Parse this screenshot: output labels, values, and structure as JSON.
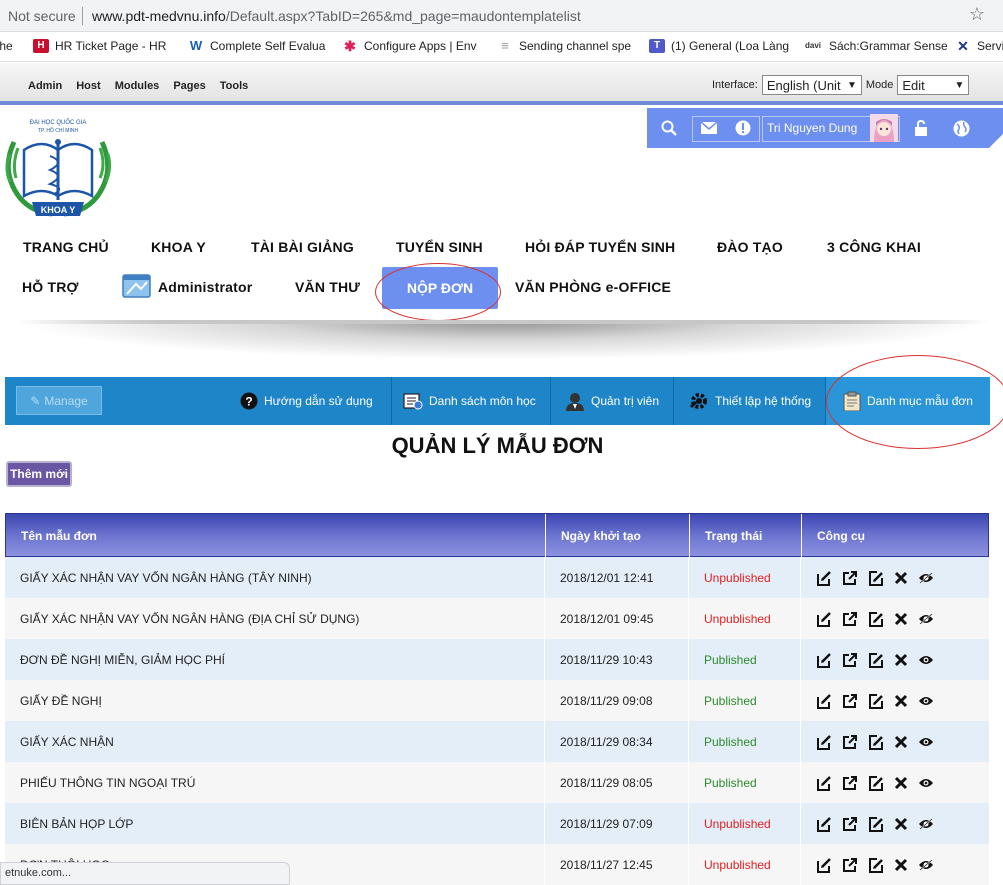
{
  "browser": {
    "security": "Not secure",
    "url_host": "www.pdt-medvnu.info",
    "url_path": "/Default.aspx?TabID=265&md_page=maudontemplatelist",
    "bookmarks": [
      {
        "label": "the",
        "icon": "bookmark-icon"
      },
      {
        "label": "HR Ticket Page - HR",
        "icon": "hr-icon"
      },
      {
        "label": "Complete Self Evalua",
        "icon": "w-icon"
      },
      {
        "label": "Configure Apps | Env",
        "icon": "slack-icon"
      },
      {
        "label": "Sending channel spe",
        "icon": "doc-icon"
      },
      {
        "label": "(1) General (Loa Làng",
        "icon": "teams-icon"
      },
      {
        "label": "Sách:Grammar Sense",
        "icon": "davi-icon"
      },
      {
        "label": "Servi",
        "icon": "tool-icon"
      }
    ]
  },
  "controlbar": {
    "menu": [
      "Admin",
      "Host",
      "Modules",
      "Pages",
      "Tools"
    ],
    "interface_label": "Interface:",
    "interface_value": "English (Unit",
    "mode_label": "Mode",
    "mode_value": "Edit"
  },
  "userbar": {
    "user_name": "Tri Nguyen Dung"
  },
  "logo": {
    "top_text": "ĐẠI HỌC QUỐC GIA",
    "city_text": "TP. HỒ CHÍ MINH",
    "ribbon_text": "KHOA Y"
  },
  "nav": {
    "row1": [
      "TRANG CHỦ",
      "KHOA Y",
      "TÀI BÀI GIẢNG",
      "TUYỂN SINH",
      "HỎI ĐÁP TUYỂN SINH",
      "ĐÀO TẠO",
      "3 CÔNG KHAI"
    ],
    "row2_support": "HỖ TRỢ",
    "row2_admin": "Administrator",
    "row2_clerical": "VĂN THƯ",
    "row2_active": "NỘP ĐƠN",
    "row2_office": "VĂN PHÒNG e-OFFICE"
  },
  "modbar": {
    "manage": "Manage",
    "items": [
      "Hướng dẫn sử dụng",
      "Danh sách môn học",
      "Quản trị viên",
      "Thiết lập hệ thống",
      "Danh mục mẫu đơn"
    ]
  },
  "page": {
    "title": "QUẢN LÝ MẪU ĐƠN",
    "add_button": "Thêm mới"
  },
  "table": {
    "headers": [
      "Tên mẫu đơn",
      "Ngày khởi tạo",
      "Trạng thái",
      "Công cụ"
    ],
    "rows": [
      {
        "name": "GIẤY XÁC NHẬN VAY VỐN NGÂN HÀNG (TÂY NINH)",
        "date": "2018/12/01 12:41",
        "status": "Unpublished"
      },
      {
        "name": "GIẤY XÁC NHẬN VAY VỐN NGÂN HÀNG (ĐỊA CHỈ SỬ DỤNG)",
        "date": "2018/12/01 09:45",
        "status": "Unpublished"
      },
      {
        "name": "ĐƠN ĐỀ NGHỊ MIỄN, GIẢM HỌC PHÍ",
        "date": "2018/11/29 10:43",
        "status": "Published"
      },
      {
        "name": "GIẤY ĐỀ NGHỊ",
        "date": "2018/11/29 09:08",
        "status": "Published"
      },
      {
        "name": "GIẤY XÁC NHẬN",
        "date": "2018/11/29 08:34",
        "status": "Published"
      },
      {
        "name": "PHIẾU THÔNG TIN NGOẠI TRÚ",
        "date": "2018/11/29 08:05",
        "status": "Published"
      },
      {
        "name": "BIÊN BẢN HỌP LỚP",
        "date": "2018/11/29 07:09",
        "status": "Unpublished"
      },
      {
        "name": "ĐƠN THÔI HỌC",
        "date": "2018/11/27 12:45",
        "status": "Unpublished"
      }
    ],
    "tool_icons": [
      "edit-icon",
      "open-external-icon",
      "edit-form-icon",
      "delete-icon",
      "view-icon"
    ]
  },
  "statusbar": {
    "text": "etnuke.com..."
  },
  "colors": {
    "accent_blue": "#6c8ff0",
    "module_bar": "#1e86c8",
    "header_purple": "#3a46b0",
    "unpublished": "#e02020",
    "published": "#2d8a2d"
  }
}
